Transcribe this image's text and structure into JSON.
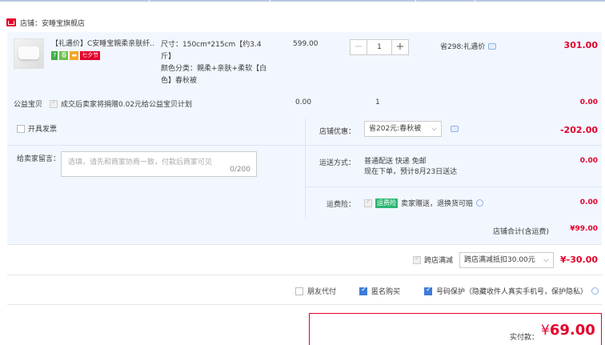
{
  "store": {
    "label": "店铺：",
    "name": "安睡宝旗舰店"
  },
  "item": {
    "title": "【礼遇价】C安睡宝親柔亲肤纤...",
    "tags": [
      {
        "text": "7",
        "color": "#3fae49"
      },
      {
        "text": "春",
        "color": "#6ec04a"
      },
      {
        "text": "▬",
        "color": "#f5a623"
      },
      {
        "text": "七夕节",
        "color": "#e4002b"
      }
    ],
    "attr_line1": "尺寸：150cm*215cm【约3.4",
    "attr_line2": "斤】",
    "attr_line3": "颜色分类：親柔+亲肤+柔软【白",
    "attr_line4": "色】春秋被",
    "price": "599.00",
    "quantity": "1",
    "minus": "−",
    "plus": "+",
    "promo": "省298:礼遇价",
    "subtotal": "301.00"
  },
  "charity": {
    "label": "公益宝贝",
    "text": "成交后卖家将捐赠0.02元给公益宝贝计划",
    "price": "0.00",
    "qty": "1",
    "subtotal": "0.00"
  },
  "invoice": {
    "label": "开具发票"
  },
  "message": {
    "label": "给卖家留言：",
    "placeholder": "选填，请先和商家协商一致，付款后商家可见",
    "count": "0/200"
  },
  "discount": {
    "label": "店铺优惠：",
    "selected": "省202元:春秋被",
    "value": "-202.00"
  },
  "shipping": {
    "label": "运送方式：",
    "line1": "普通配送 快递 免邮",
    "line2": "现在下单，预计8月23日送达",
    "value": "0.00"
  },
  "insurance": {
    "label": "运费险：",
    "badge": "运费险",
    "text": "卖家赠送，退换货可赔",
    "value": "0.00"
  },
  "store_total": {
    "label": "店铺合计(含运费)",
    "value": "¥99.00"
  },
  "cross_store": {
    "label": "跨店满减",
    "selected": "跨店满减抵扣30.00元",
    "value": "¥-30.00"
  },
  "options": [
    {
      "label": "朋友代付",
      "checked": false
    },
    {
      "label": "匿名购买",
      "checked": true
    },
    {
      "label": "号码保护（隐藏收件人真实手机号，保护隐私）",
      "checked": true
    }
  ],
  "payment": {
    "label": "实付款：",
    "symbol": "¥",
    "amount": "69.00"
  },
  "colors": {
    "accent_red": "#e4002b",
    "panel_blue": "#f2f7ff",
    "check_blue": "#3e7bd8",
    "insurance_green": "#2bb673"
  }
}
